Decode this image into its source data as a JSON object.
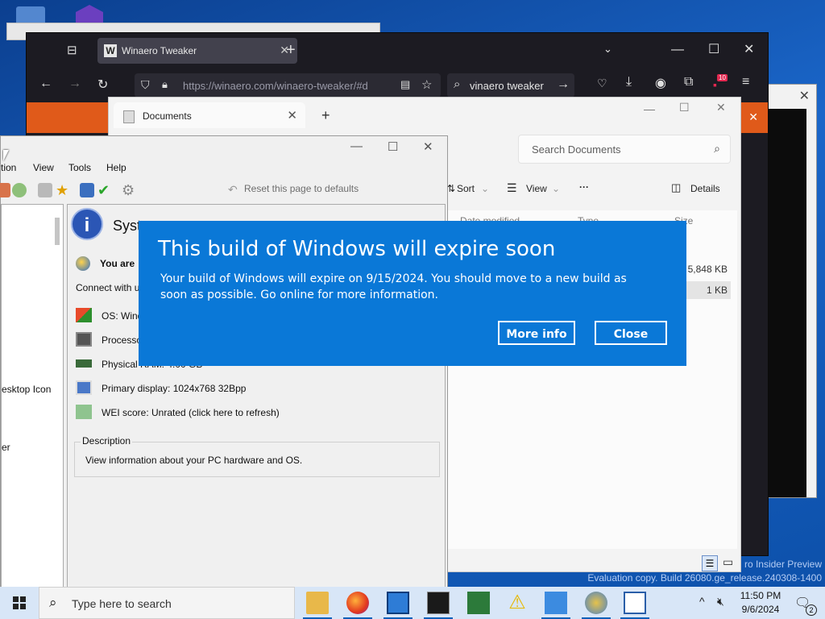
{
  "firefox": {
    "tab_title": "Winaero Tweaker",
    "tab_favicon": "W",
    "url": "https://winaero.com/winaero-tweaker/#d",
    "search_query": "vinaero tweaker",
    "notification_count": "10",
    "accent_color": "#e05a1a"
  },
  "explorer": {
    "tab_title": "Documents",
    "search_placeholder": "Search Documents",
    "toolbar": {
      "sort": "Sort",
      "view": "View",
      "more": "···",
      "details": "Details"
    },
    "columns": {
      "date": "Date modified",
      "type": "Type",
      "size": "Size"
    },
    "rows": [
      {
        "size": "5,848 KB"
      },
      {
        "size": "1 KB"
      }
    ]
  },
  "tweaker": {
    "menu": [
      "tion",
      "View",
      "Tools",
      "Help"
    ],
    "reset_label": "Reset this page to defaults",
    "page_title": "Syste",
    "you_are": "You are",
    "connect": "Connect with us:",
    "rows": [
      "OS: Windo",
      "Processor",
      "Physical RAM: 4.00 GB",
      "Primary display: 1024x768 32Bpp",
      "WEI score: Unrated (click here to refresh)"
    ],
    "left_items": [
      "esktop Icon",
      "er"
    ],
    "description_legend": "Description",
    "description_text": "View information about your PC hardware and OS."
  },
  "dialog": {
    "title": "This build of Windows will expire soon",
    "body": "Your build of Windows will expire on 9/15/2024. You should move to a new build as soon as possible. Go online for more information.",
    "more_info": "More info",
    "close": "Close",
    "background_color": "#0a78d7"
  },
  "desktop": {
    "watermark_line1": "ro Insider Preview",
    "watermark_line2": "Evaluation copy. Build 26080.ge_release.240308-1400"
  },
  "taskbar": {
    "search_placeholder": "Type here to search",
    "time": "11:50 PM",
    "date": "9/6/2024",
    "notification_count": "2"
  }
}
